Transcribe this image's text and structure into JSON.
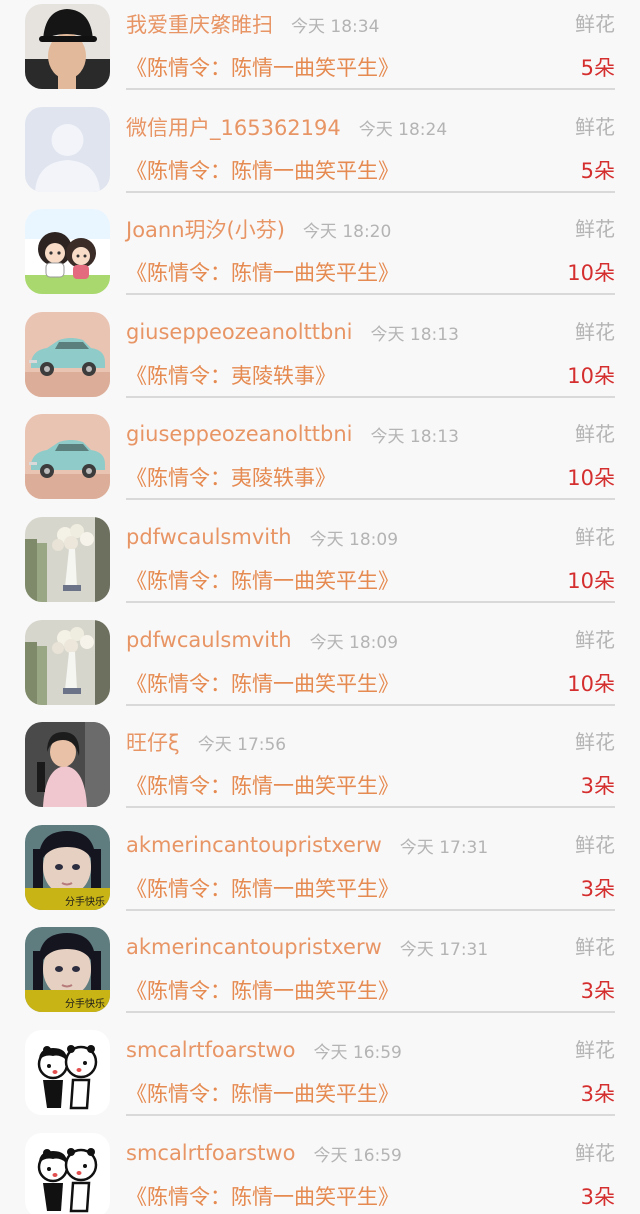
{
  "colors": {
    "username": "#e89565",
    "time": "#b4b4b4",
    "book_title": "#e58a50",
    "gift_count": "#d42e2e",
    "divider": "#d9d9d9",
    "background": "#f9f8f8"
  },
  "items": [
    {
      "username": "我爱重庆綮睢扫",
      "time": "今天 18:34",
      "gift_type": "鲜花",
      "book": "《陈情令：陈情一曲笑平生》",
      "count": "5朵",
      "avatar": "man-black-hat-avatar"
    },
    {
      "username": "微信用户_165362194",
      "time": "今天 18:24",
      "gift_type": "鲜花",
      "book": "《陈情令：陈情一曲笑平生》",
      "count": "5朵",
      "avatar": "default-silhouette-avatar"
    },
    {
      "username": "Joann玥汐(小芬)",
      "time": "今天 18:20",
      "gift_type": "鲜花",
      "book": "《陈情令：陈情一曲笑平生》",
      "count": "10朵",
      "avatar": "anime-chibi-avatar"
    },
    {
      "username": "giuseppeozeanolttbni",
      "time": "今天 18:13",
      "gift_type": "鲜花",
      "book": "《陈情令：夷陵轶事》",
      "count": "10朵",
      "avatar": "vintage-car-avatar"
    },
    {
      "username": "giuseppeozeanolttbni",
      "time": "今天 18:13",
      "gift_type": "鲜花",
      "book": "《陈情令：夷陵轶事》",
      "count": "10朵",
      "avatar": "vintage-car-avatar"
    },
    {
      "username": "pdfwcaulsmvith",
      "time": "今天 18:09",
      "gift_type": "鲜花",
      "book": "《陈情令：陈情一曲笑平生》",
      "count": "10朵",
      "avatar": "flower-bouquet-avatar"
    },
    {
      "username": "pdfwcaulsmvith",
      "time": "今天 18:09",
      "gift_type": "鲜花",
      "book": "《陈情令：陈情一曲笑平生》",
      "count": "10朵",
      "avatar": "flower-bouquet-avatar"
    },
    {
      "username": "旺仔ξ",
      "time": "今天 17:56",
      "gift_type": "鲜花",
      "book": "《陈情令：陈情一曲笑平生》",
      "count": "3朵",
      "avatar": "girl-pink-sweater-avatar"
    },
    {
      "username": "akmerincantoupristxerw",
      "time": "今天 17:31",
      "gift_type": "鲜花",
      "book": "《陈情令：陈情一曲笑平生》",
      "count": "3朵",
      "avatar": "girl-bangs-avatar",
      "avatar_caption": "分手快乐"
    },
    {
      "username": "akmerincantoupristxerw",
      "time": "今天 17:31",
      "gift_type": "鲜花",
      "book": "《陈情令：陈情一曲笑平生》",
      "count": "3朵",
      "avatar": "girl-bangs-avatar",
      "avatar_caption": "分手快乐"
    },
    {
      "username": "smcalrtfoarstwo",
      "time": "今天 16:59",
      "gift_type": "鲜花",
      "book": "《陈情令：陈情一曲笑平生》",
      "count": "3朵",
      "avatar": "kissing-cartoon-avatar"
    },
    {
      "username": "smcalrtfoarstwo",
      "time": "今天 16:59",
      "gift_type": "鲜花",
      "book": "《陈情令：陈情一曲笑平生》",
      "count": "3朵",
      "avatar": "kissing-cartoon-avatar"
    }
  ]
}
